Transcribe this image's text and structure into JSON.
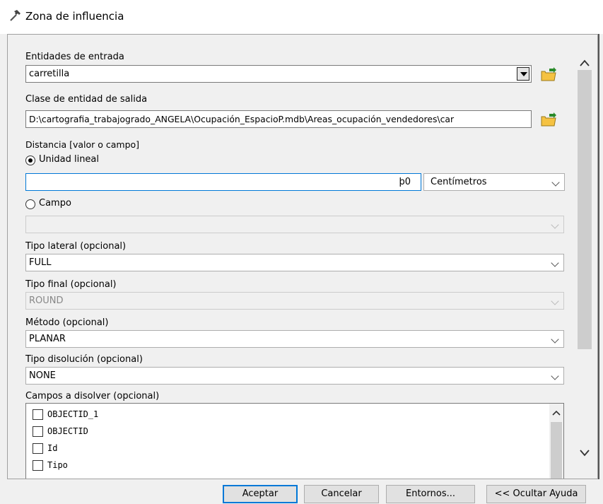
{
  "window": {
    "title": "Zona de influencia"
  },
  "form": {
    "input_features_label": "Entidades de entrada",
    "input_features_value": "carretilla",
    "output_class_label": "Clase de entidad de salida",
    "output_class_value": "D:\\cartografia_trabajogrado_ANGELA\\Ocupación_EspacioP.mdb\\Areas_ocupación_vendedores\\car",
    "distance_label": "Distancia [valor o campo]",
    "linear_unit_label": "Unidad lineal",
    "linear_unit_value": "þ0",
    "unit_select": "Centímetros",
    "field_label": "Campo",
    "field_value": "",
    "side_type_label": "Tipo lateral (opcional)",
    "side_type_value": "FULL",
    "end_type_label": "Tipo final (opcional)",
    "end_type_value": "ROUND",
    "method_label": "Método (opcional)",
    "method_value": "PLANAR",
    "dissolve_type_label": "Tipo disolución (opcional)",
    "dissolve_type_value": "NONE",
    "dissolve_fields_label": "Campos a disolver (opcional)",
    "dissolve_fields": [
      "OBJECTID_1",
      "OBJECTID",
      "Id",
      "Tipo"
    ]
  },
  "buttons": {
    "ok": "Aceptar",
    "cancel": "Cancelar",
    "environments": "Entornos...",
    "hide_help": "<< Ocultar Ayuda"
  },
  "colors": {
    "accent": "#0078d7",
    "folder": "#f5c242"
  }
}
